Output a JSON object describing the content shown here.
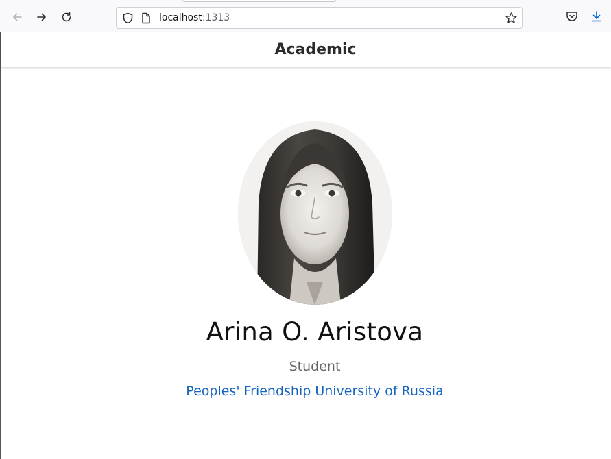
{
  "browser": {
    "url_host": "localhost",
    "url_port": ":1313"
  },
  "site": {
    "brand": "Academic"
  },
  "profile": {
    "name": "Arina O. Aristova",
    "role": "Student",
    "organization": "Peoples' Friendship University of Russia"
  },
  "colors": {
    "link": "#1565c0",
    "role_text": "#666666"
  },
  "icons": [
    "back-icon",
    "forward-icon",
    "reload-icon",
    "shield-icon",
    "page-icon",
    "bookmark-star-icon",
    "pocket-icon",
    "download-icon"
  ]
}
